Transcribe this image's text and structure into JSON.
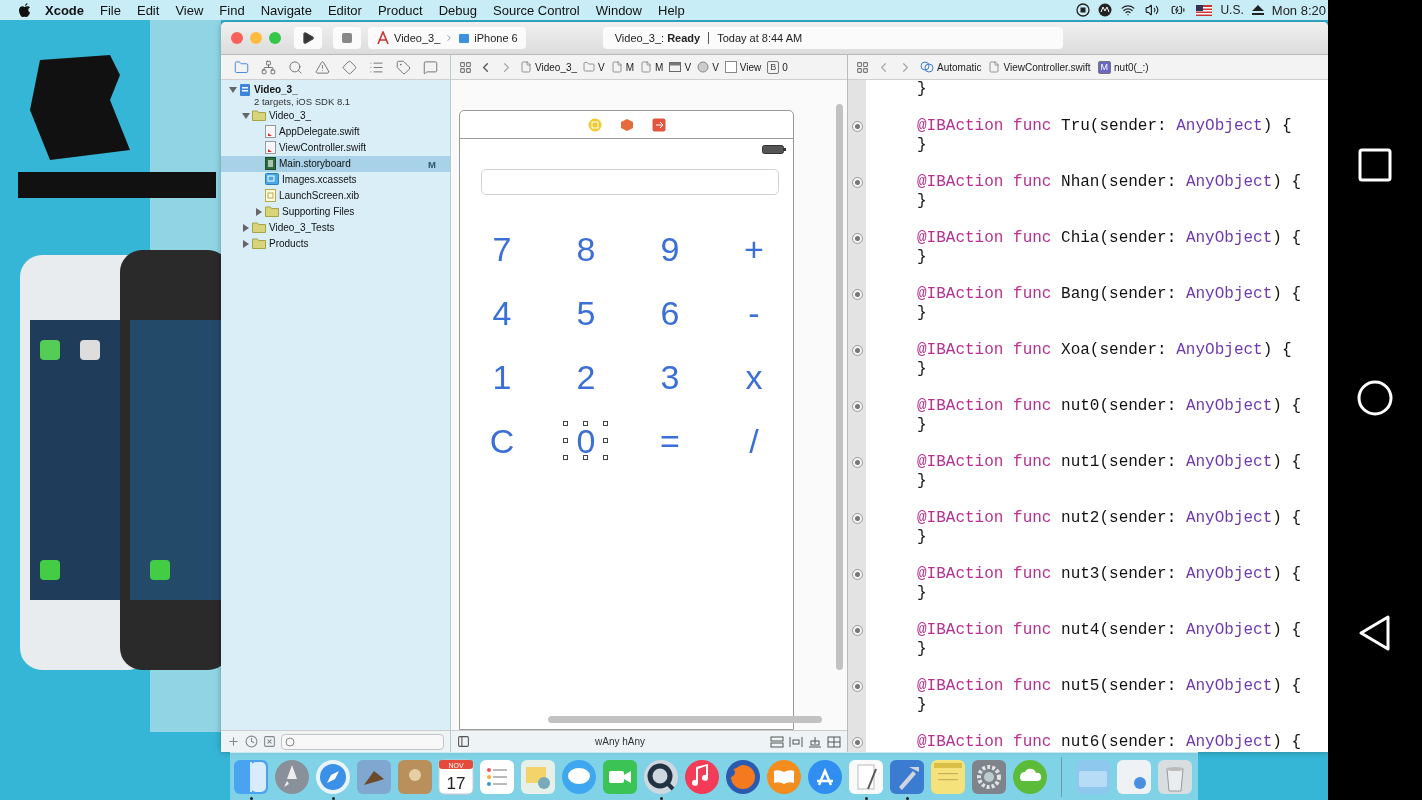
{
  "menu_bar": {
    "app": "Xcode",
    "items": [
      "File",
      "Edit",
      "View",
      "Find",
      "Navigate",
      "Editor",
      "Product",
      "Debug",
      "Source Control",
      "Window",
      "Help"
    ],
    "keyboard": "U.S.",
    "clock": "Mon 8:20"
  },
  "window": {
    "toolbar": {
      "scheme": "Video_3_",
      "device": "iPhone 6",
      "status": "Video_3_: **Ready**",
      "time": "Today at 8:44 AM"
    },
    "navigator": {
      "tabs": [
        {
          "kind": "folder",
          "selected": true
        },
        {
          "kind": "hierarchy",
          "selected": false
        },
        {
          "kind": "search",
          "selected": false
        },
        {
          "kind": "warning",
          "selected": false
        },
        {
          "kind": "diamond",
          "selected": false
        },
        {
          "kind": "list",
          "selected": false
        },
        {
          "kind": "tag",
          "selected": false
        },
        {
          "kind": "chat",
          "selected": false
        }
      ],
      "tree": [
        {
          "label": "Video_3_",
          "subtitle": "2 targets, iOS SDK 8.1",
          "kind": "project",
          "expanded": true,
          "selected": false,
          "children": [
            {
              "label": "Video_3_",
              "kind": "folder",
              "expanded": true,
              "selected": false,
              "children": [
                {
                  "label": "AppDelegate.swift",
                  "kind": "swift",
                  "selected": false
                },
                {
                  "label": "ViewController.swift",
                  "kind": "swift",
                  "selected": false
                },
                {
                  "label": "Main.storyboard",
                  "kind": "storyboard",
                  "selected": true,
                  "badge": "M"
                },
                {
                  "label": "Images.xcassets",
                  "kind": "assets",
                  "selected": false
                },
                {
                  "label": "LaunchScreen.xib",
                  "kind": "xib",
                  "selected": false
                },
                {
                  "label": "Supporting Files",
                  "kind": "folder",
                  "expanded": false,
                  "selected": false
                }
              ]
            },
            {
              "label": "Video_3_Tests",
              "kind": "folder",
              "expanded": false,
              "selected": false
            },
            {
              "label": "Products",
              "kind": "folder",
              "expanded": false,
              "selected": false
            }
          ]
        }
      ]
    },
    "canvas": {
      "crumbs": [
        {
          "kind": "file",
          "text": "Video_3_"
        },
        {
          "kind": "folder",
          "text": "V"
        },
        {
          "kind": "file",
          "text": "M"
        },
        {
          "kind": "file",
          "text": "M"
        },
        {
          "kind": "scene",
          "text": "V"
        },
        {
          "kind": "controller",
          "text": "V"
        },
        {
          "kind": "view",
          "text": "View"
        },
        {
          "kind": "letter",
          "icon_letter": "B",
          "text": "0"
        }
      ],
      "keys": [
        {
          "label": "7",
          "selected": false
        },
        {
          "label": "8",
          "selected": false
        },
        {
          "label": "9",
          "selected": false
        },
        {
          "label": "+",
          "selected": false
        },
        {
          "label": "4",
          "selected": false
        },
        {
          "label": "5",
          "selected": false
        },
        {
          "label": "6",
          "selected": false
        },
        {
          "label": "-",
          "selected": false
        },
        {
          "label": "1",
          "selected": false
        },
        {
          "label": "2",
          "selected": false
        },
        {
          "label": "3",
          "selected": false
        },
        {
          "label": "x",
          "selected": false
        },
        {
          "label": "C",
          "selected": false
        },
        {
          "label": "0",
          "selected": true
        },
        {
          "label": "=",
          "selected": false
        },
        {
          "label": "/",
          "selected": false
        }
      ],
      "size_class": "wAny hAny"
    },
    "editor": {
      "crumbs": [
        {
          "kind": "automatic",
          "text": "Automatic"
        },
        {
          "kind": "file",
          "text": "ViewController.swift"
        },
        {
          "kind": "method",
          "icon_letter": "M",
          "text": "nut0(_:)"
        }
      ],
      "lines": [
        {
          "kind": "brace",
          "text": "}"
        },
        {
          "kind": "action",
          "parts": [
            "@IBAction",
            "func",
            "Tru(sender: ",
            "AnyObject",
            ") {"
          ]
        },
        {
          "kind": "brace",
          "text": "}"
        },
        {
          "kind": "action",
          "parts": [
            "@IBAction",
            "func",
            "Nhan(sender: ",
            "AnyObject",
            ") {"
          ]
        },
        {
          "kind": "brace",
          "text": "}"
        },
        {
          "kind": "action",
          "parts": [
            "@IBAction",
            "func",
            "Chia(sender: ",
            "AnyObject",
            ") {"
          ]
        },
        {
          "kind": "brace",
          "text": "}"
        },
        {
          "kind": "action",
          "parts": [
            "@IBAction",
            "func",
            "Bang(sender: ",
            "AnyObject",
            ") {"
          ]
        },
        {
          "kind": "brace",
          "text": "}"
        },
        {
          "kind": "action",
          "parts": [
            "@IBAction",
            "func",
            "Xoa(sender: ",
            "AnyObject",
            ") {"
          ]
        },
        {
          "kind": "brace",
          "text": "}"
        },
        {
          "kind": "action",
          "parts": [
            "@IBAction",
            "func",
            "nut0(sender: ",
            "AnyObject",
            ") {"
          ]
        },
        {
          "kind": "brace",
          "text": "}"
        },
        {
          "kind": "action",
          "parts": [
            "@IBAction",
            "func",
            "nut1(sender: ",
            "AnyObject",
            ") {"
          ]
        },
        {
          "kind": "brace",
          "text": "}"
        },
        {
          "kind": "action",
          "parts": [
            "@IBAction",
            "func",
            "nut2(sender: ",
            "AnyObject",
            ") {"
          ]
        },
        {
          "kind": "brace",
          "text": "}"
        },
        {
          "kind": "action",
          "parts": [
            "@IBAction",
            "func",
            "nut3(sender: ",
            "AnyObject",
            ") {"
          ]
        },
        {
          "kind": "brace",
          "text": "}"
        },
        {
          "kind": "action",
          "parts": [
            "@IBAction",
            "func",
            "nut4(sender: ",
            "AnyObject",
            ") {"
          ]
        },
        {
          "kind": "brace",
          "text": "}"
        },
        {
          "kind": "action",
          "parts": [
            "@IBAction",
            "func",
            "nut5(sender: ",
            "AnyObject",
            ") {"
          ]
        },
        {
          "kind": "brace",
          "text": "}"
        },
        {
          "kind": "action",
          "parts": [
            "@IBAction",
            "func",
            "nut6(sender: ",
            "AnyObject",
            ") {"
          ]
        }
      ]
    }
  },
  "dock": [
    {
      "kind": "finder",
      "running": true
    },
    {
      "kind": "launchpad",
      "running": false
    },
    {
      "kind": "safari",
      "running": true
    },
    {
      "kind": "preview",
      "running": false
    },
    {
      "kind": "contacts",
      "running": false
    },
    {
      "kind": "calendar",
      "running": false,
      "month": "NOV",
      "day": "17"
    },
    {
      "kind": "reminders",
      "running": false
    },
    {
      "kind": "photos",
      "running": false
    },
    {
      "kind": "messages",
      "running": false
    },
    {
      "kind": "facetime",
      "running": false
    },
    {
      "kind": "quicktime",
      "running": true
    },
    {
      "kind": "music",
      "running": false
    },
    {
      "kind": "firefox",
      "running": false
    },
    {
      "kind": "books",
      "running": false
    },
    {
      "kind": "appstore",
      "running": false
    },
    {
      "kind": "textedit",
      "running": true
    },
    {
      "kind": "xcode",
      "running": true
    },
    {
      "kind": "notes",
      "running": false
    },
    {
      "kind": "settings",
      "running": false
    },
    {
      "kind": "cloud",
      "running": false
    },
    {
      "kind": "separator"
    },
    {
      "kind": "folder",
      "running": false
    },
    {
      "kind": "document",
      "running": false
    },
    {
      "kind": "trash",
      "running": false
    }
  ]
}
